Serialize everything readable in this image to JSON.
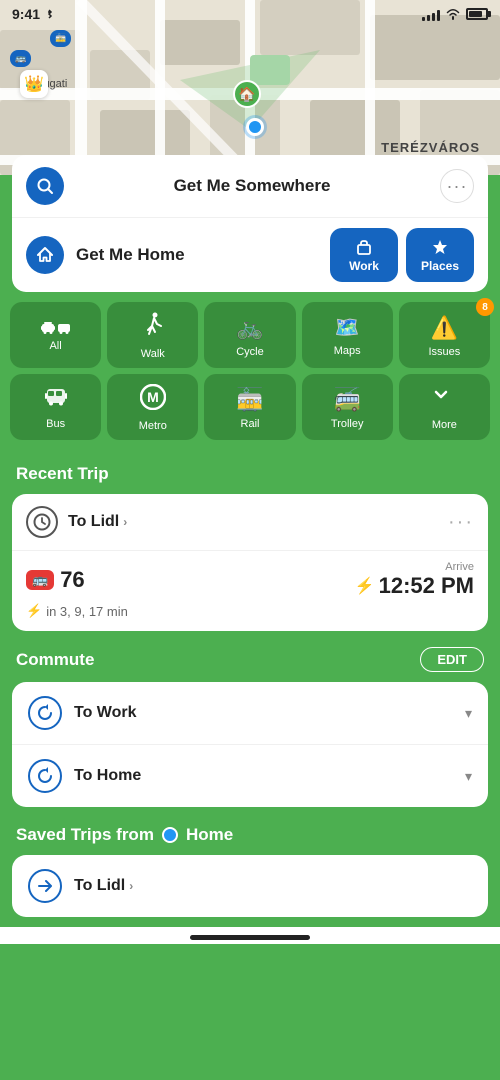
{
  "statusBar": {
    "time": "9:41",
    "batteryPercent": 80
  },
  "map": {
    "locationLabel": "TERÉZVÁROS",
    "nyugatiLabel": "Nyugati"
  },
  "searchBar": {
    "placeholder": "Get Me Somewhere",
    "moreIcon": "···"
  },
  "homeRow": {
    "label": "Get Me Home",
    "workBtn": "Work",
    "placesBtn": "Places"
  },
  "transportGrid": {
    "items": [
      {
        "id": "all",
        "label": "All",
        "icon": "🚌"
      },
      {
        "id": "walk",
        "label": "Walk",
        "icon": "🚶"
      },
      {
        "id": "cycle",
        "label": "Cycle",
        "icon": "🚲"
      },
      {
        "id": "maps",
        "label": "Maps",
        "icon": "🗺️"
      },
      {
        "id": "issues",
        "label": "Issues",
        "icon": "⚠️",
        "badge": "8"
      },
      {
        "id": "bus",
        "label": "Bus",
        "icon": "🚌"
      },
      {
        "id": "metro",
        "label": "Metro",
        "icon": "Ⓜ️"
      },
      {
        "id": "rail",
        "label": "Rail",
        "icon": "🚋"
      },
      {
        "id": "trolley",
        "label": "Trolley",
        "icon": "🚎"
      },
      {
        "id": "more",
        "label": "More",
        "icon": "✓"
      }
    ]
  },
  "recentTrip": {
    "sectionTitle": "Recent Trip",
    "destination": "To Lidl",
    "busNumber": "76",
    "arriveLabel": "Arrive",
    "arriveTime": "12:52 PM",
    "nextBuses": "in 3, 9, 17 min"
  },
  "commute": {
    "sectionTitle": "Commute",
    "editLabel": "EDIT",
    "items": [
      {
        "id": "to-work",
        "label": "To Work"
      },
      {
        "id": "to-home",
        "label": "To Home"
      }
    ]
  },
  "savedTrips": {
    "sectionTitle": "Saved Trips from",
    "locationName": "Home",
    "items": [
      {
        "id": "to-lidl",
        "label": "To Lidl"
      }
    ]
  },
  "icons": {
    "search": "🔍",
    "home": "🏠",
    "work": "💼",
    "star": "★",
    "clock": "🕐",
    "rotate": "↻",
    "arrow": "→"
  }
}
